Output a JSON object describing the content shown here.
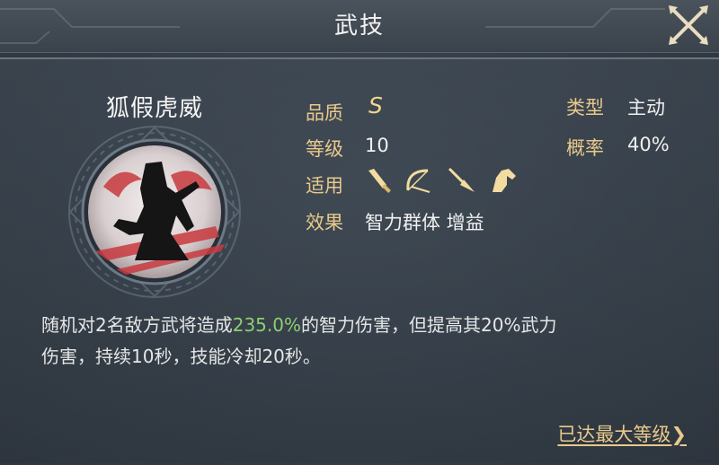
{
  "window": {
    "title": "武技"
  },
  "skill": {
    "name": "狐假虎威",
    "quality_label": "品质",
    "quality_value": "S",
    "level_label": "等级",
    "level_value": "10",
    "applies_label": "适用",
    "applies_icons": [
      "sword-icon",
      "bow-icon",
      "spear-icon",
      "horse-icon"
    ],
    "effect_label": "效果",
    "effect_value": "智力群体 增益",
    "type_label": "类型",
    "type_value": "主动",
    "rate_label": "概率",
    "rate_value": "40%"
  },
  "description": {
    "part1": "随机对2名敌方武将造成",
    "highlight": "235.0%",
    "part2": "的智力伤害，但提高其20%武力",
    "line2": "伤害，持续10秒，技能冷却20秒。"
  },
  "footer": {
    "max_level_link": "已达最大等级",
    "arrow": "❯"
  },
  "colors": {
    "label_gold": "#e8c98c",
    "highlight_green": "#8ccf72",
    "icon_gold": "#f3dca0"
  }
}
